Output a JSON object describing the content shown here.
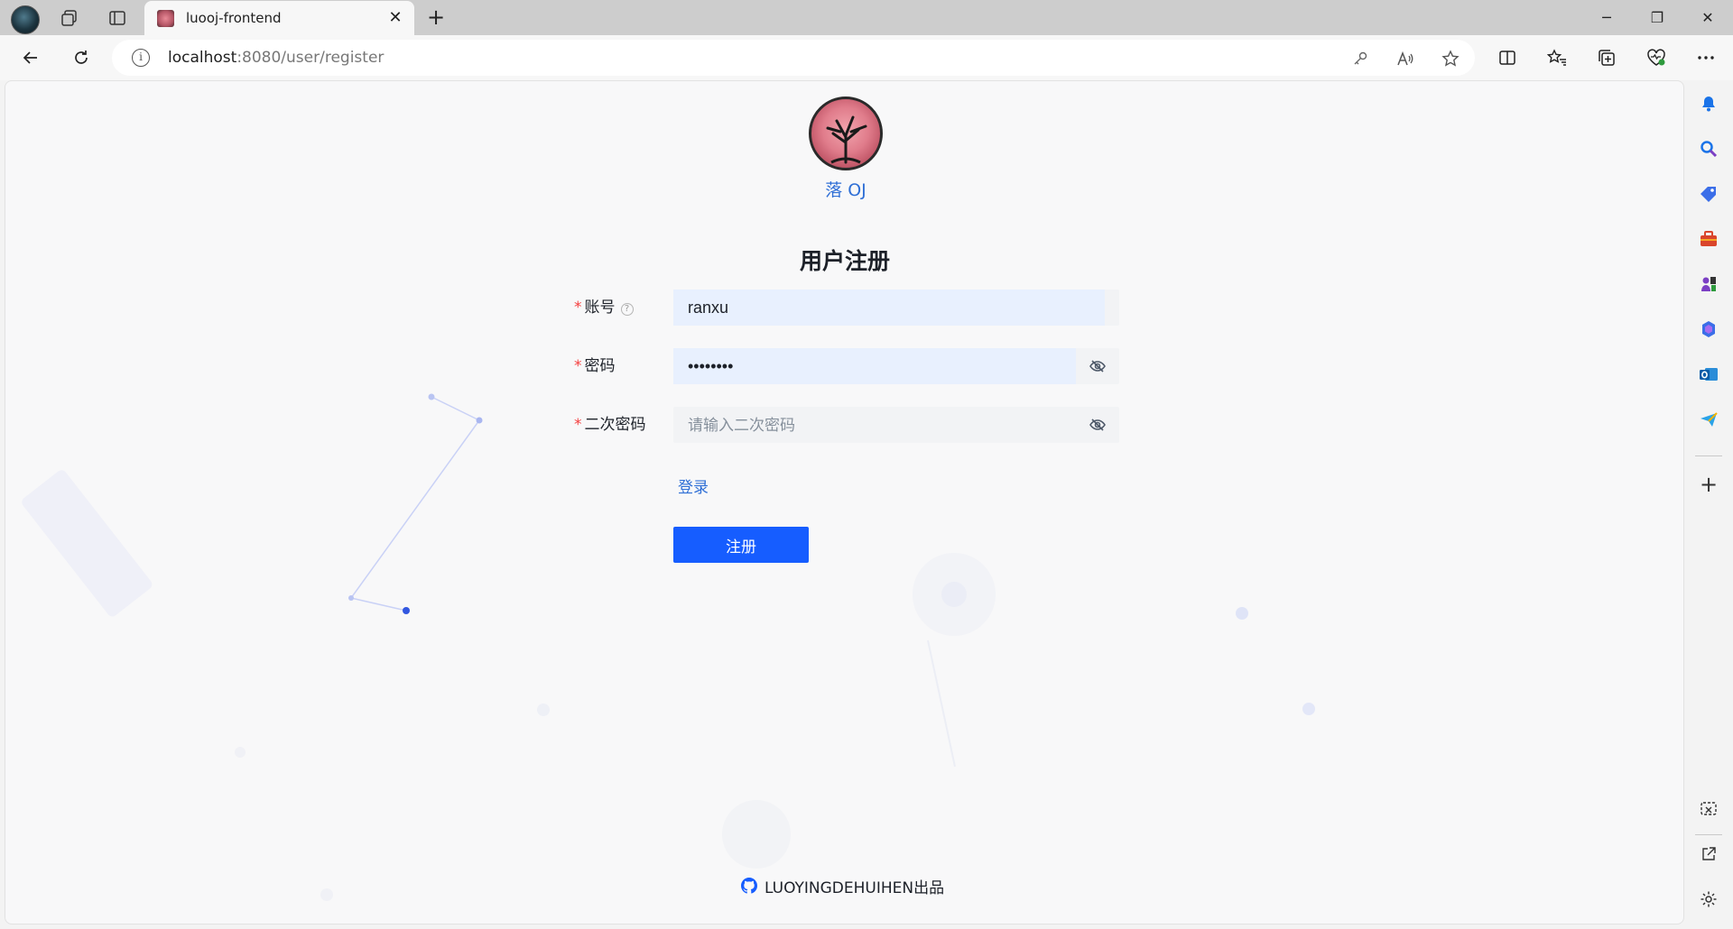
{
  "browser": {
    "tab": {
      "title": "luooj-frontend"
    },
    "new_tab_label": "+",
    "url": {
      "host": "localhost",
      "path": ":8080/user/register"
    },
    "window_controls": {
      "minimize": "─",
      "maximize": "❐",
      "close": "✕"
    }
  },
  "page": {
    "site_title": "落 OJ",
    "form_title": "用户注册",
    "fields": {
      "account": {
        "label": "账号",
        "value": "ranxu",
        "required": "*",
        "help": "?"
      },
      "password": {
        "label": "密码",
        "value": "••••••••",
        "required": "*"
      },
      "confirm_password": {
        "label": "二次密码",
        "value": "",
        "placeholder": "请输入二次密码",
        "required": "*"
      }
    },
    "login_link": "登录",
    "register_button": "注册",
    "footer_text": "LUOYINGDEHUIHEN出品"
  },
  "colors": {
    "primary": "#165dff",
    "link": "#2f6fd6",
    "required": "#f53f3f",
    "field_bg": "#f2f3f5",
    "autofill_bg": "#e8f0fe"
  },
  "icons": {
    "tabbar": [
      "profile-avatar",
      "workspaces-icon",
      "tab-actions-icon"
    ],
    "address_bar": [
      "info-icon",
      "key-icon",
      "read-aloud-icon",
      "favorite-star-icon"
    ],
    "toolbar": [
      "split-screen-icon",
      "favorites-icon",
      "collections-icon",
      "browser-essentials-icon",
      "more-icon"
    ],
    "sidebar": [
      "bell-icon",
      "search-icon",
      "shopping-icon",
      "tools-icon",
      "games-icon",
      "copilot-icon",
      "outlook-icon",
      "telegram-icon",
      "add-icon",
      "screenshot-icon",
      "open-external-icon",
      "settings-icon"
    ]
  }
}
